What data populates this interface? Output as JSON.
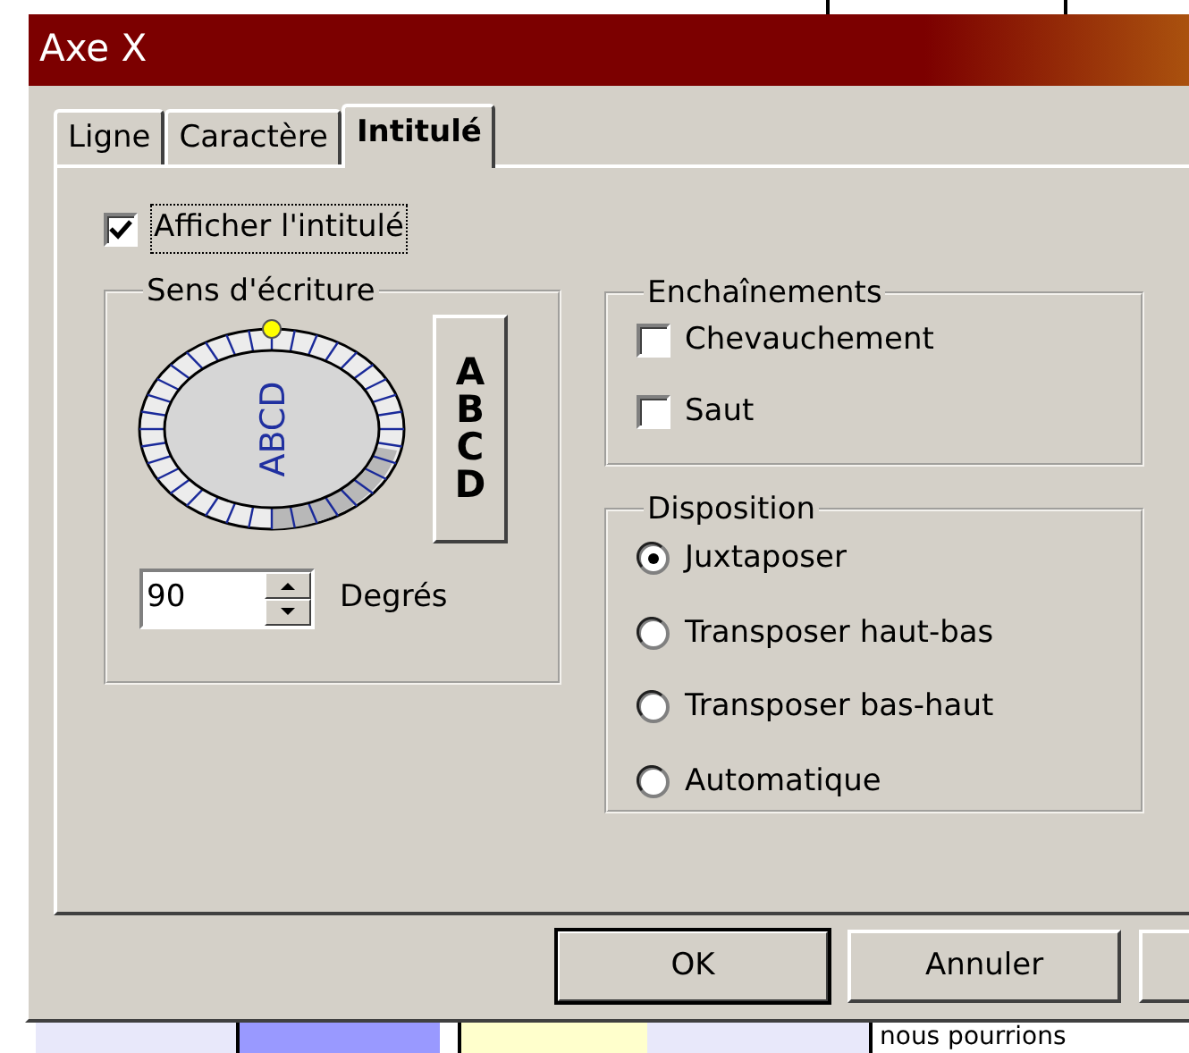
{
  "window": {
    "title": "Axe X"
  },
  "tabs": [
    {
      "label": "Ligne",
      "selected": false
    },
    {
      "label": "Caractère",
      "selected": false
    },
    {
      "label": "Intitulé",
      "selected": true
    }
  ],
  "show_label": {
    "label": "Afficher l'intitulé",
    "checked": true,
    "focused": true
  },
  "writing_direction": {
    "title": "Sens d'écriture",
    "dial_text": "ABCD",
    "vertical_button": "ABCD",
    "degrees": {
      "value": "90",
      "unit": "Degrés"
    }
  },
  "chaining": {
    "title": "Enchaînements",
    "options": [
      {
        "label": "Chevauchement",
        "checked": false
      },
      {
        "label": "Saut",
        "checked": false
      }
    ]
  },
  "layout": {
    "title": "Disposition",
    "options": [
      {
        "label": "Juxtaposer",
        "selected": true
      },
      {
        "label": "Transposer haut-bas",
        "selected": false
      },
      {
        "label": "Transposer bas-haut",
        "selected": false
      },
      {
        "label": "Automatique",
        "selected": false
      }
    ]
  },
  "buttons": [
    "OK",
    "Annuler"
  ],
  "background": {
    "cell_text": "nous pourrions"
  }
}
